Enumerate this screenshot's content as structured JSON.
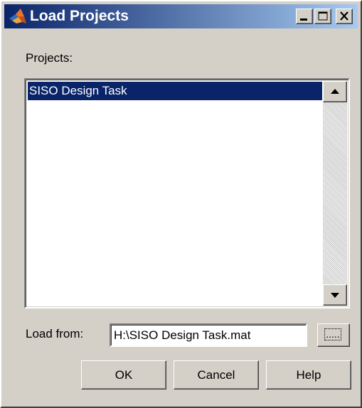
{
  "window": {
    "title": "Load Projects",
    "colors": {
      "titlebar_start": "#0a246a",
      "titlebar_end": "#a6caf0",
      "face": "#d4d0c8",
      "selection": "#0a246a"
    },
    "controls": {
      "minimize_icon": "minimize-icon",
      "maximize_icon": "maximize-icon",
      "close_icon": "close-icon"
    }
  },
  "projects": {
    "label": "Projects:",
    "items": [
      {
        "label": "SISO Design Task",
        "selected": true
      }
    ]
  },
  "load_from": {
    "label": "Load from:",
    "value": "H:\\SISO Design Task.mat",
    "browse_label": "....."
  },
  "buttons": {
    "ok": "OK",
    "cancel": "Cancel",
    "help": "Help"
  }
}
